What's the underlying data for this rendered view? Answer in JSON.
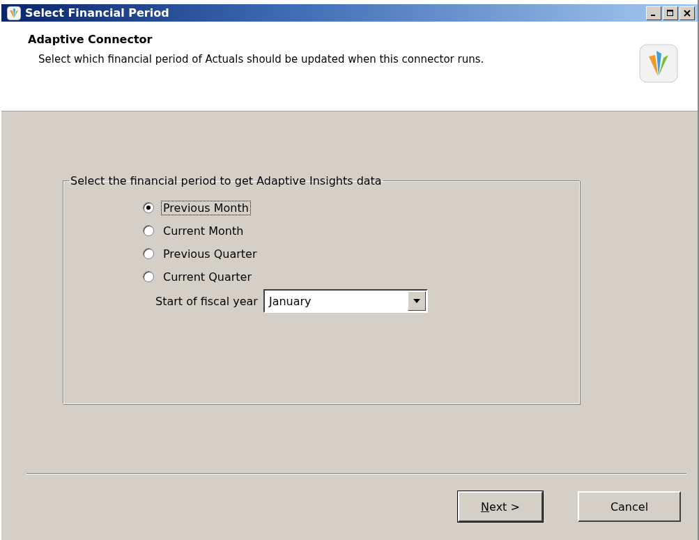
{
  "window": {
    "title": "Select Financial Period"
  },
  "header": {
    "title": "Adaptive Connector",
    "description": "Select which financial period of Actuals should be updated when this connector runs."
  },
  "group": {
    "legend": "Select the financial period to get Adaptive Insights data",
    "options": [
      {
        "label": "Previous Month",
        "selected": true
      },
      {
        "label": "Current Month",
        "selected": false
      },
      {
        "label": "Previous Quarter",
        "selected": false
      },
      {
        "label": "Current Quarter",
        "selected": false
      }
    ],
    "fiscal_year": {
      "label": "Start of fiscal year",
      "value": "January"
    }
  },
  "buttons": [
    {
      "label": "Next >",
      "default": true
    },
    {
      "label": "Cancel",
      "default": false
    }
  ]
}
